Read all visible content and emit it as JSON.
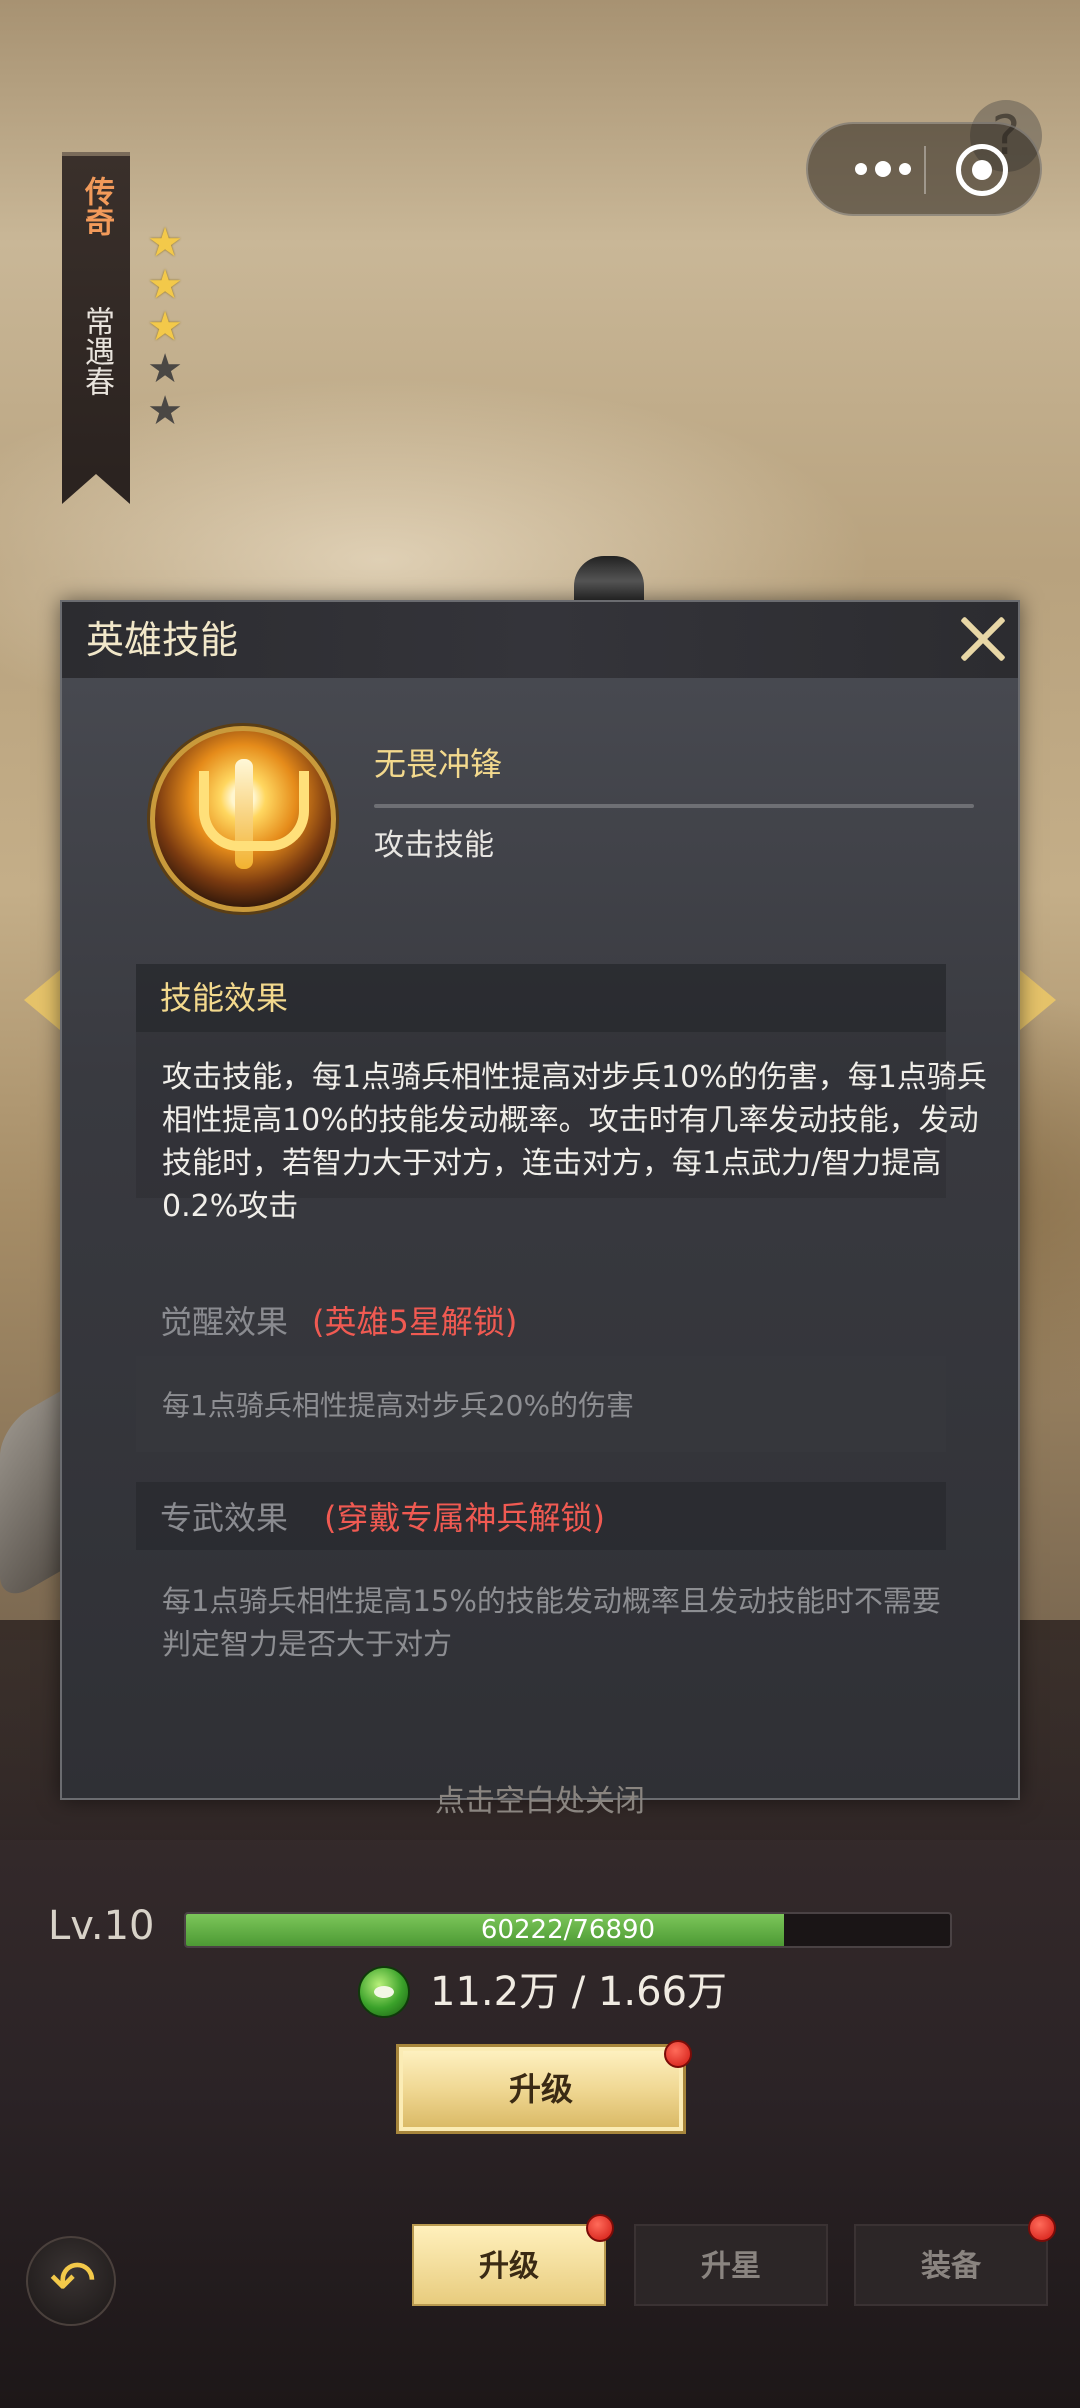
{
  "hero": {
    "rarity": "传奇",
    "name": "常遇春",
    "stars": {
      "filled": 3,
      "total": 5
    }
  },
  "capsule": {
    "more_icon": "more-dots-icon",
    "close_icon": "target-close-icon"
  },
  "modal": {
    "title": "英雄技能",
    "close_icon": "close-x-icon",
    "skill": {
      "name": "无畏冲锋",
      "type": "攻击技能"
    },
    "effect": {
      "header": "技能效果",
      "text": "攻击技能，每1点骑兵相性提高对步兵10%的伤害，每1点骑兵相性提高10%的技能发动概率。攻击时有几率发动技能，发动技能时，若智力大于对方，连击对方，每1点武力/智力提高0.2%攻击"
    },
    "awaken": {
      "label": "觉醒效果",
      "unlock": "(英雄5星解锁)",
      "text": "每1点骑兵相性提高对步兵20%的伤害"
    },
    "exclusive": {
      "label": "专武效果",
      "unlock": "(穿戴专属神兵解锁)",
      "text": "每1点骑兵相性提高15%的技能发动概率且发动技能时不需要判定智力是否大于对方"
    }
  },
  "hint": "点击空白处关闭",
  "level": {
    "label": "Lv.10",
    "xp_text": "60222/76890",
    "xp_current": 60222,
    "xp_max": 76890
  },
  "cost": {
    "text": "11.2万 / 1.66万"
  },
  "upgrade_button": "升级",
  "tabs": [
    {
      "label": "升级",
      "active": true
    },
    {
      "label": "升星",
      "active": false
    },
    {
      "label": "装备",
      "active": false
    }
  ],
  "colors": {
    "accent_gold": "#f3d98d",
    "unlock_red": "#f05a52",
    "xp_green": "#5fae44"
  }
}
